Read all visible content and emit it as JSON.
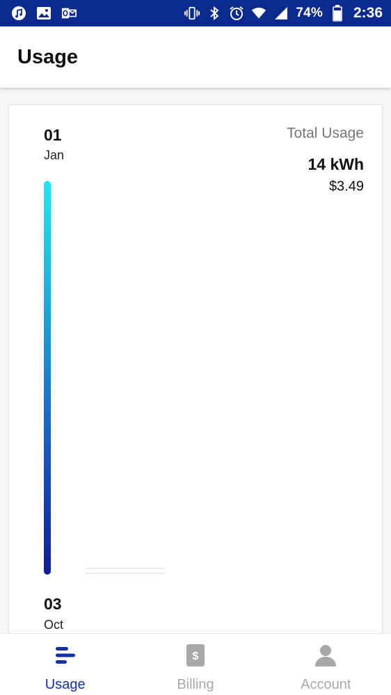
{
  "status_bar": {
    "battery": "74%",
    "time": "2:36",
    "left_icons": [
      "music-app-icon",
      "gallery-icon",
      "outlook-icon"
    ],
    "right_icons": [
      "vibrate-icon",
      "bluetooth-icon",
      "alarm-icon",
      "wifi-icon",
      "signal-icon",
      "battery-icon"
    ]
  },
  "app_bar": {
    "title": "Usage"
  },
  "usage": {
    "start_day": "01",
    "start_month": "Jan",
    "end_day": "03",
    "end_month": "Oct",
    "total_label": "Total Usage",
    "total_kwh": "14 kWh",
    "total_cost": "$3.49"
  },
  "bottom_nav": {
    "items": [
      {
        "label": "Usage",
        "icon": "usage-icon",
        "active": true
      },
      {
        "label": "Billing",
        "icon": "billing-icon",
        "active": false
      },
      {
        "label": "Account",
        "icon": "account-icon",
        "active": false
      }
    ]
  },
  "colors": {
    "status_bar": "#0b2a8f",
    "accent": "#1231a8",
    "bar_top": "#1fe8f3",
    "bar_bottom": "#101c9a",
    "inactive": "#a8a8a8"
  }
}
